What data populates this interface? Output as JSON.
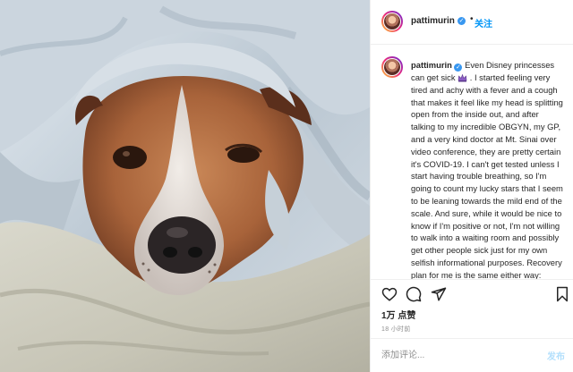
{
  "post": {
    "username": "pattimurin",
    "follow_label": "关注",
    "separator": "•",
    "verified_mark": "✓",
    "caption": "Even Disney princesses can get sick",
    "caption_cont": "I started feeling very tired and achy with a fever and a cough that makes it feel like my head is splitting open from the inside out, and after talking to my incredible OBGYN, my GP, and a very kind doctor at Mt. Sinai over video conference, they are pretty certain it's COVID-19. I can't get tested unless I start having trouble breathing, so I'm going to count my lucky stars that I seem to be leaning towards the mild end of the scale. And sure, while it would be nice to know if I'm positive or not, I'm not willing to walk into a waiting room and possibly get other people sick just for my own selfish informational purposes. Recovery plan for me is the same either way: sleep, tons of fluids,",
    "emoji": "crown-emoji",
    "likes": "1万 点赞",
    "time_ago": "18 小时前"
  },
  "actions": {
    "like_icon": "heart-icon",
    "comment_icon": "comment-icon",
    "share_icon": "paper-plane-icon",
    "save_icon": "bookmark-icon"
  },
  "comment": {
    "placeholder": "添加评论...",
    "post_label": "发布"
  },
  "colors": {
    "link_blue": "#0095f6",
    "verified_blue": "#3897f0",
    "post_disabled": "#b2dffc",
    "muted": "#8e8e8e"
  }
}
